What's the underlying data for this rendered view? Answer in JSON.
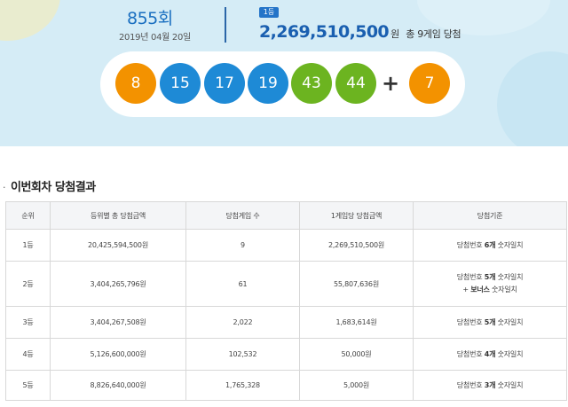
{
  "draw": {
    "round": "855회",
    "date": "2019년 04월 20일",
    "rank_badge": "1등",
    "first_prize_amount": "2,269,510,500",
    "first_prize_unit": "원",
    "first_prize_winners": "총 9게임 당첨"
  },
  "balls": {
    "numbers": [
      {
        "value": "8",
        "color": "#f39200"
      },
      {
        "value": "15",
        "color": "#1e8ad6"
      },
      {
        "value": "17",
        "color": "#1e8ad6"
      },
      {
        "value": "19",
        "color": "#1e8ad6"
      },
      {
        "value": "43",
        "color": "#6cb420"
      },
      {
        "value": "44",
        "color": "#6cb420"
      }
    ],
    "plus": "+",
    "bonus": {
      "value": "7",
      "color": "#f39200"
    }
  },
  "section": {
    "bullet": "·",
    "title": "이번회차 당첨결과"
  },
  "table": {
    "headers": [
      "순위",
      "등위별 총 당첨금액",
      "당첨게임 수",
      "1게임당 당첨금액",
      "당첨기준"
    ],
    "rows": [
      {
        "rank": "1등",
        "total": "20,425,594,500원",
        "games": "9",
        "per_game": "2,269,510,500원",
        "criteria": [
          {
            "pre": "당첨번호 ",
            "bold": "6개",
            "post": " 숫자일치"
          }
        ]
      },
      {
        "rank": "2등",
        "total": "3,404,265,796원",
        "games": "61",
        "per_game": "55,807,636원",
        "criteria": [
          {
            "pre": "당첨번호 ",
            "bold": "5개",
            "post": " 숫자일치"
          },
          {
            "pre": "+ ",
            "bold": "보너스",
            "post": " 숫자일치"
          }
        ]
      },
      {
        "rank": "3등",
        "total": "3,404,267,508원",
        "games": "2,022",
        "per_game": "1,683,614원",
        "criteria": [
          {
            "pre": "당첨번호 ",
            "bold": "5개",
            "post": " 숫자일치"
          }
        ]
      },
      {
        "rank": "4등",
        "total": "5,126,600,000원",
        "games": "102,532",
        "per_game": "50,000원",
        "criteria": [
          {
            "pre": "당첨번호 ",
            "bold": "4개",
            "post": " 숫자일치"
          }
        ]
      },
      {
        "rank": "5등",
        "total": "8,826,640,000원",
        "games": "1,765,328",
        "per_game": "5,000원",
        "criteria": [
          {
            "pre": "당첨번호 ",
            "bold": "3개",
            "post": " 숫자일치"
          }
        ]
      }
    ]
  }
}
